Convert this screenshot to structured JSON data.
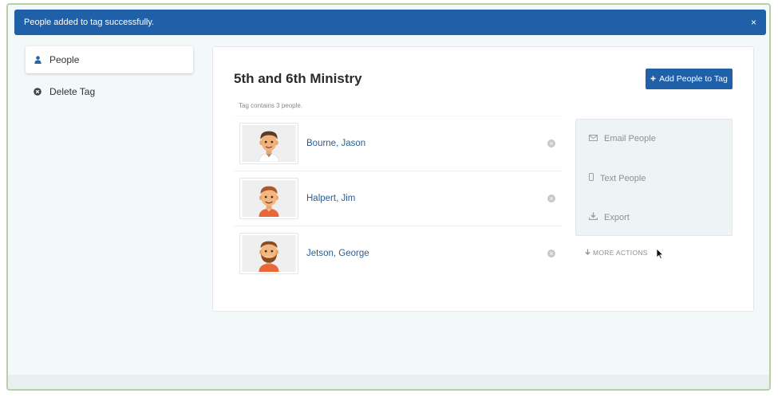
{
  "alert": {
    "message": "People added to tag successfully.",
    "close_glyph": "×"
  },
  "sidebar": {
    "items": [
      {
        "label": "People",
        "icon": "person-icon",
        "active": true
      },
      {
        "label": "Delete Tag",
        "icon": "remove-circle-icon",
        "active": false
      }
    ]
  },
  "tag": {
    "title": "5th and 6th Ministry",
    "add_button_label": "Add People to Tag",
    "count_text": "Tag contains 3 people."
  },
  "people": [
    {
      "name": "Bourne, Jason",
      "avatar": "avatar-jason"
    },
    {
      "name": "Halpert, Jim",
      "avatar": "avatar-jim"
    },
    {
      "name": "Jetson, George",
      "avatar": "avatar-george"
    }
  ],
  "actions": {
    "email": "Email People",
    "text": "Text People",
    "export": "Export",
    "more": "MORE ACTIONS"
  },
  "colors": {
    "brand_blue": "#1f60a8",
    "link_blue": "#2a5e93",
    "frame_border": "#b9cfa6"
  }
}
